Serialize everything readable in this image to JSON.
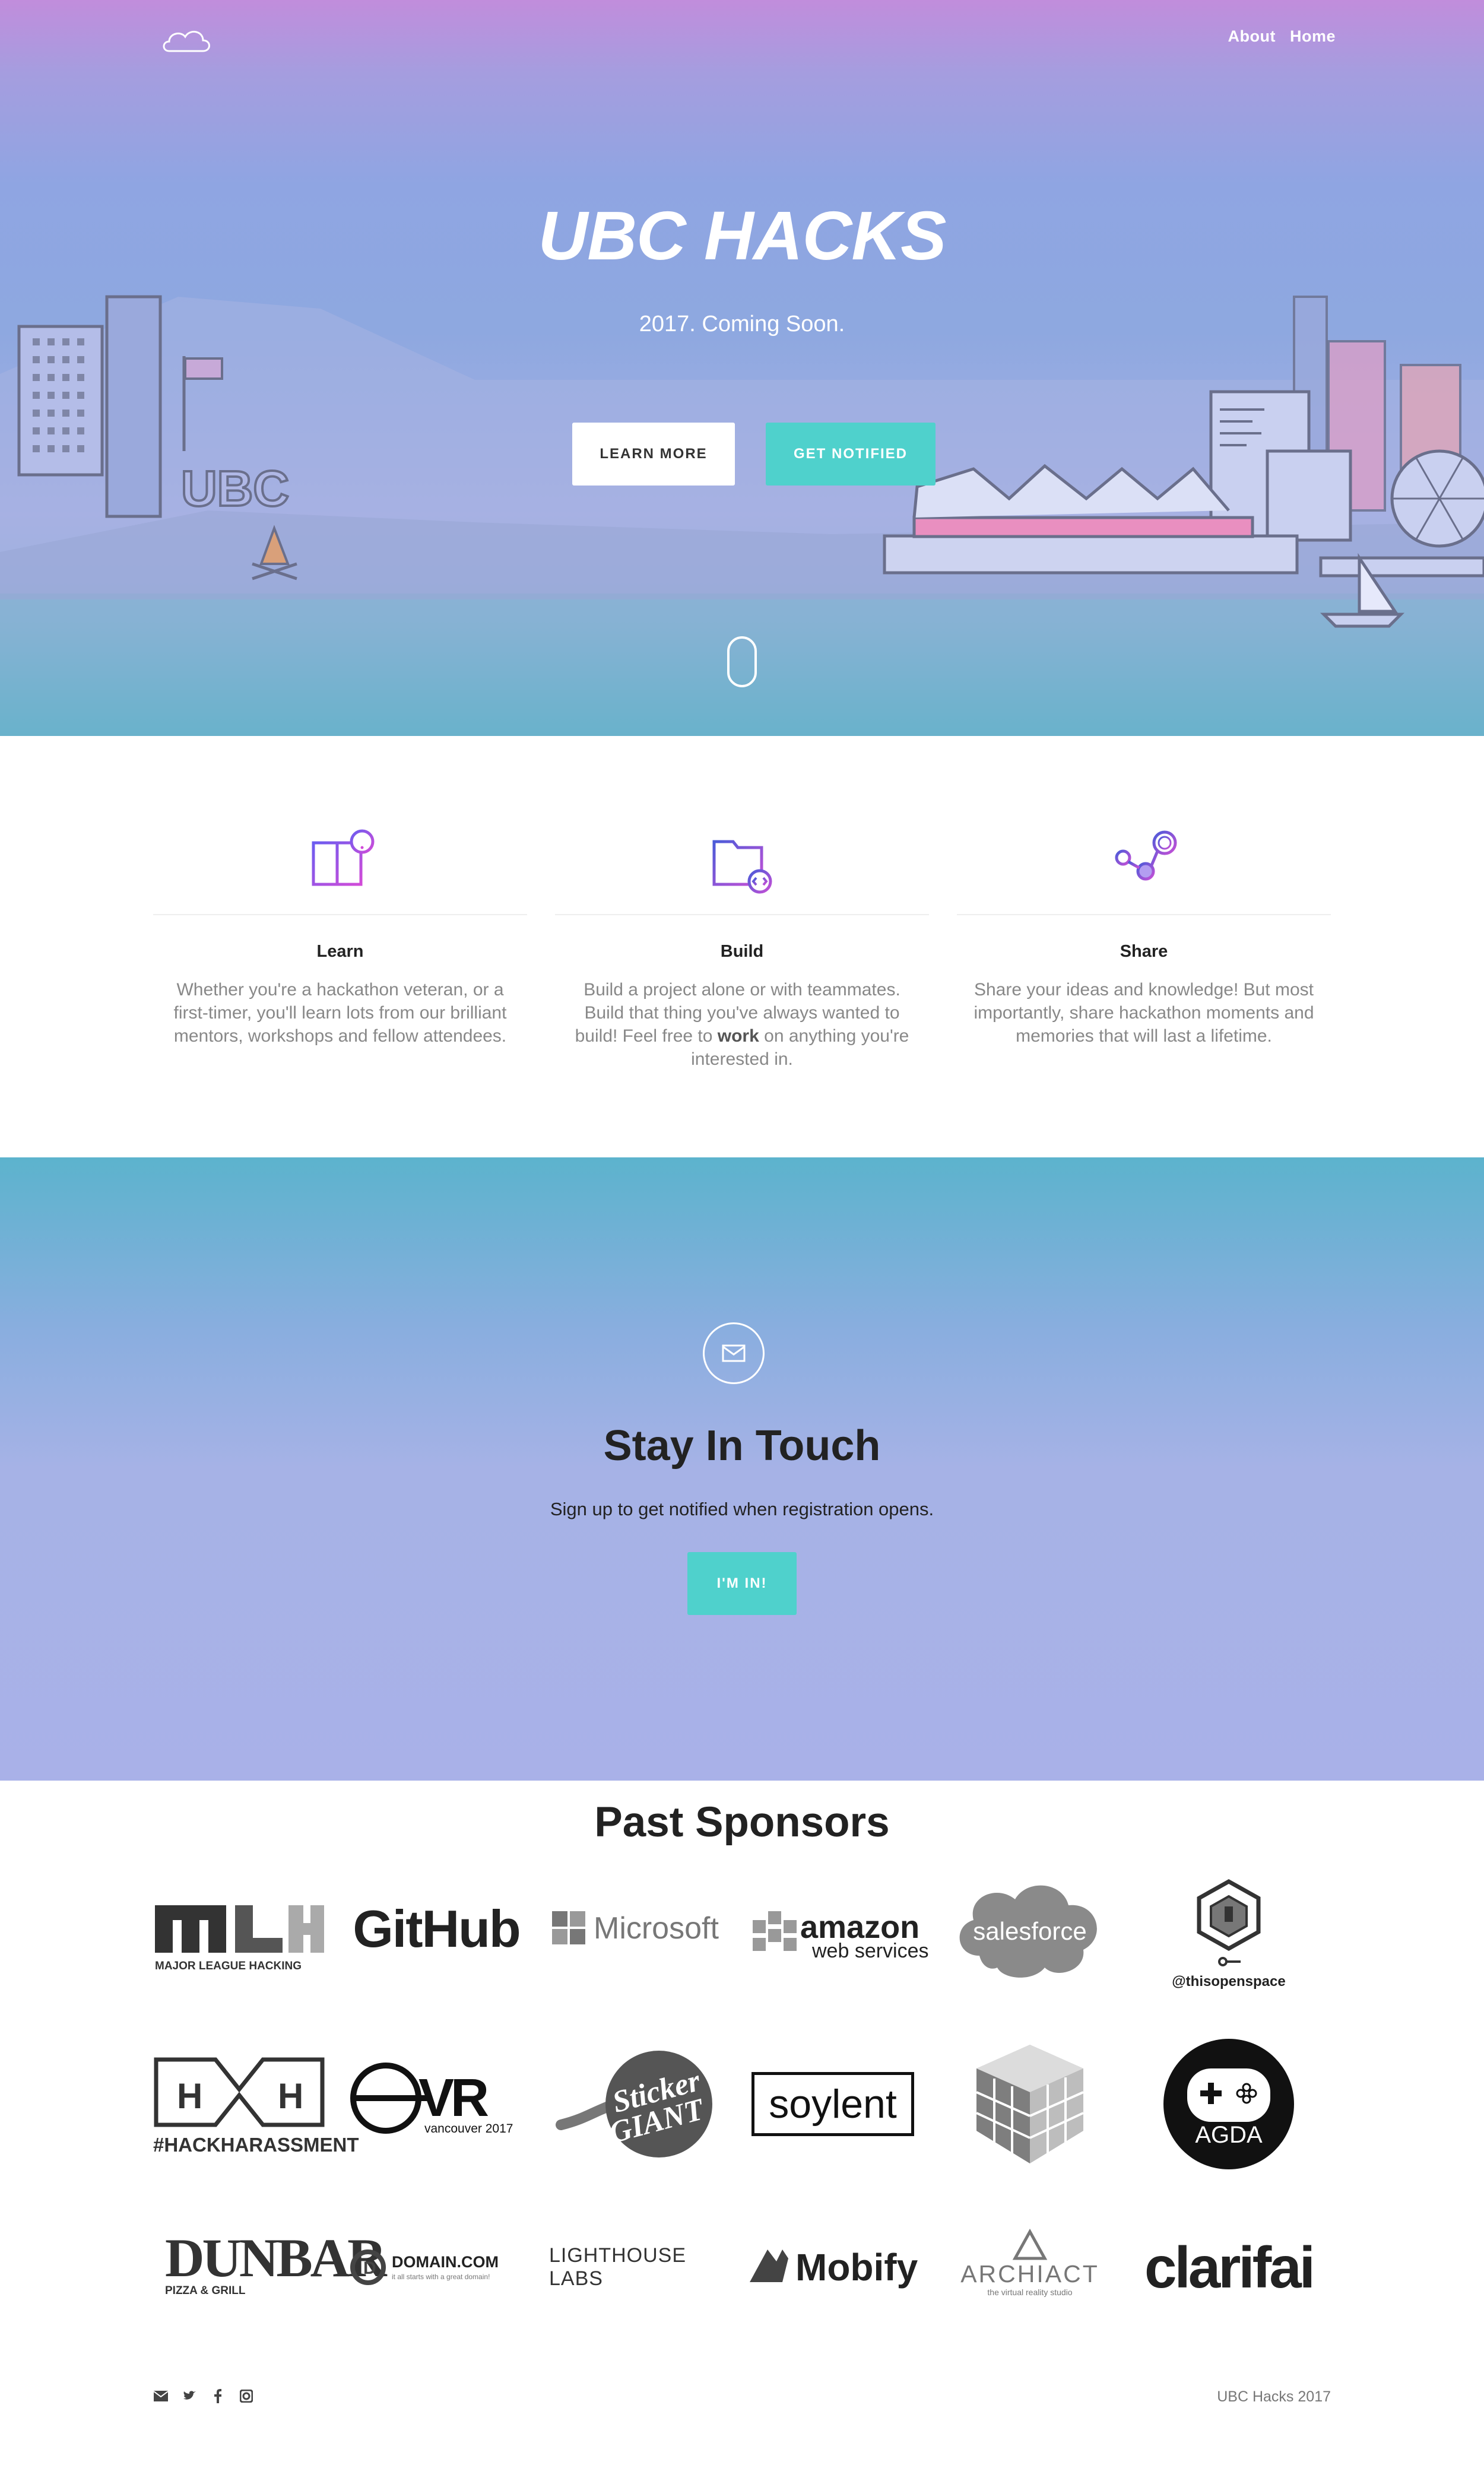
{
  "nav": {
    "logo": "cloud-logo",
    "links": [
      "About",
      "Home"
    ]
  },
  "hero": {
    "title": "UBC HACKS",
    "subtitle": "2017. Coming Soon.",
    "learn_more": "LEARN MORE",
    "get_notified": "GET NOTIFIED",
    "skyline_sign": "UBC"
  },
  "features": [
    {
      "icon": "book-icon",
      "title": "Learn",
      "text": "Whether you're a hackathon veteran, or a first-timer, you'll learn lots from our brilliant mentors, workshops and fellow attendees."
    },
    {
      "icon": "code-folder-icon",
      "title": "Build",
      "text_before": "Build a project alone or with teammates. Build that thing you've always wanted to build! Feel free to ",
      "text_bold": "work",
      "text_after": " on anything you're interested in."
    },
    {
      "icon": "share-icon",
      "title": "Share",
      "text": "Share your ideas and knowledge! But most importantly, share hackathon moments and memories that will last a lifetime."
    }
  ],
  "touch": {
    "icon": "envelope-icon",
    "title": "Stay In Touch",
    "subtitle": "Sign up to get notified when registration opens.",
    "button": "I'M IN!"
  },
  "sponsors": {
    "title": "Past Sponsors",
    "logos": [
      {
        "name": "MLH",
        "caption": "MAJOR LEAGUE HACKING"
      },
      {
        "name": "GitHub"
      },
      {
        "name": "Microsoft"
      },
      {
        "name": "amazon",
        "caption": "web services"
      },
      {
        "name": "salesforce"
      },
      {
        "name": "@thisopenspace"
      },
      {
        "name": "#HACKHARASSMENT"
      },
      {
        "name": "VR",
        "caption": "vancouver 2017"
      },
      {
        "name": "Sticker GIANT"
      },
      {
        "name": "soylent"
      },
      {
        "name": "cube-logo"
      },
      {
        "name": "AGDA"
      },
      {
        "name": "DUNBAR",
        "caption": "PIZZA & GRILL"
      },
      {
        "name": "DOMAIN.COM",
        "caption": "it all starts with a great domain!"
      },
      {
        "name": "LIGHTHOUSE LABS"
      },
      {
        "name": "Mobify"
      },
      {
        "name": "ARCHIACT",
        "caption": "the virtual reality studio"
      },
      {
        "name": "clarifai"
      }
    ]
  },
  "footer": {
    "icons": [
      "envelope-icon",
      "twitter-icon",
      "facebook-icon",
      "instagram-icon"
    ],
    "copyright": "UBC Hacks 2017"
  },
  "colors": {
    "accent": "#4fd1cc",
    "hero_top": "#c18ddc",
    "hero_bottom": "#4fb0c6"
  }
}
